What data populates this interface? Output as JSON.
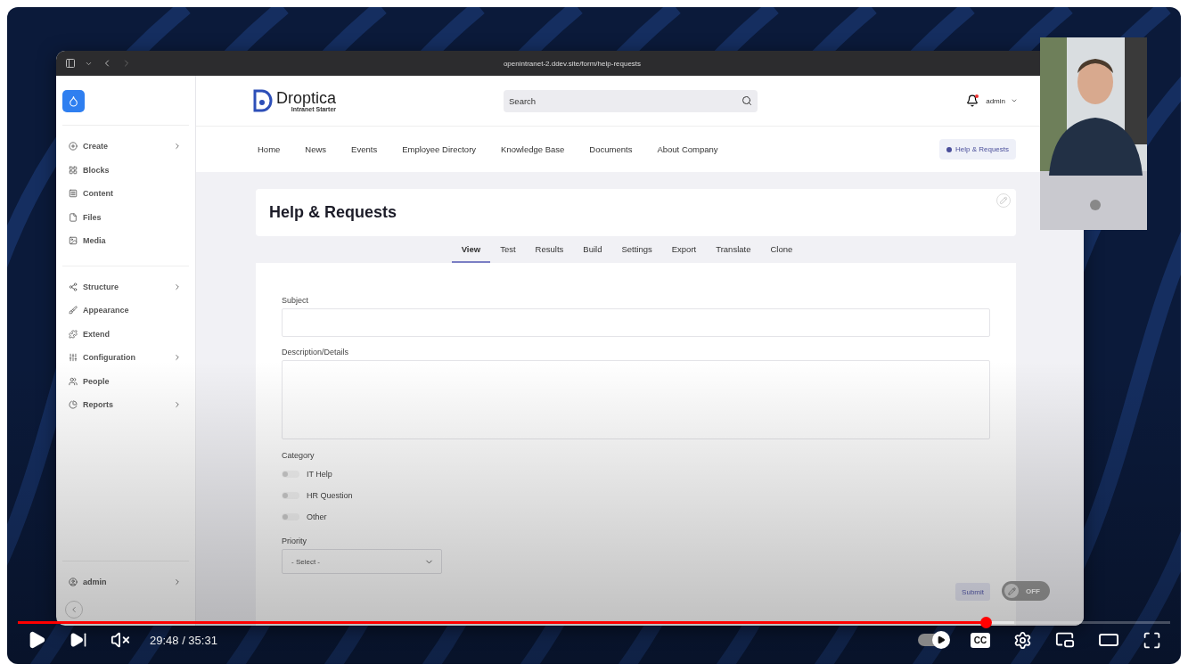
{
  "player": {
    "time": "29:48 / 35:31",
    "progress": {
      "level": 0.84
    },
    "buffered": {
      "level": 0.865
    },
    "muted": true,
    "autoplay": true,
    "captions_button": "CC"
  },
  "browser": {
    "url": "openintranet-2.ddev.site/form/help-requests"
  },
  "admin_sidebar": {
    "groups": [
      [
        {
          "label": "Create",
          "has_submenu": true
        },
        {
          "label": "Blocks",
          "has_submenu": false
        },
        {
          "label": "Content",
          "has_submenu": false
        },
        {
          "label": "Files",
          "has_submenu": false
        },
        {
          "label": "Media",
          "has_submenu": false
        }
      ],
      [
        {
          "label": "Structure",
          "has_submenu": true
        },
        {
          "label": "Appearance",
          "has_submenu": false
        },
        {
          "label": "Extend",
          "has_submenu": false
        },
        {
          "label": "Configuration",
          "has_submenu": true
        },
        {
          "label": "People",
          "has_submenu": false
        },
        {
          "label": "Reports",
          "has_submenu": true
        }
      ]
    ],
    "user": {
      "label": "admin",
      "has_submenu": true
    }
  },
  "site_header": {
    "logo": {
      "name": "Droptica",
      "tagline": "Intranet Starter"
    },
    "search": {
      "placeholder": "Search"
    },
    "notifications_unread": true,
    "user": "admin"
  },
  "main_nav": {
    "items": [
      "Home",
      "News",
      "Events",
      "Employee Directory",
      "Knowledge Base",
      "Documents",
      "About Company"
    ],
    "help_button": "Help & Requests"
  },
  "page": {
    "title": "Help & Requests",
    "tabs": [
      {
        "label": "View",
        "selected": true
      },
      {
        "label": "Test",
        "selected": false
      },
      {
        "label": "Results",
        "selected": false
      },
      {
        "label": "Build",
        "selected": false
      },
      {
        "label": "Settings",
        "selected": false
      },
      {
        "label": "Export",
        "selected": false
      },
      {
        "label": "Translate",
        "selected": false
      },
      {
        "label": "Clone",
        "selected": false
      }
    ],
    "form": {
      "fields": [
        {
          "kind": "text",
          "label": "Subject"
        },
        {
          "kind": "textarea",
          "label": "Description/Details"
        },
        {
          "kind": "radios",
          "label": "Category",
          "options": [
            {
              "label": "IT Help",
              "selected": false
            },
            {
              "label": "HR Question",
              "selected": false
            },
            {
              "label": "Other",
              "selected": false
            }
          ]
        },
        {
          "kind": "select",
          "label": "Priority",
          "value": "- Select -"
        }
      ],
      "submit": "Submit"
    },
    "edit_toggle": {
      "label": "OFF",
      "on": false
    }
  }
}
